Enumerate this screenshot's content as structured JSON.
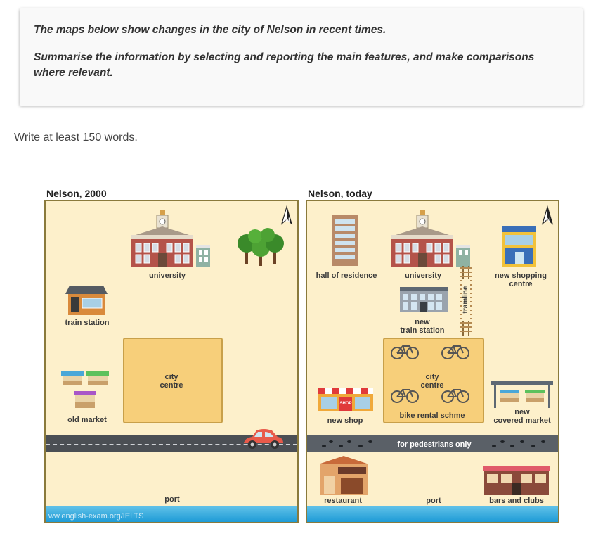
{
  "task": {
    "line1": "The maps below show changes in the city of Nelson in recent times.",
    "line2": "Summarise the information by selecting and reporting the main features, and make comparisons where relevant."
  },
  "instruction": "Write at least 150 words.",
  "map_2000": {
    "title": "Nelson, 2000",
    "labels": {
      "university": "university",
      "train_station": "train station",
      "city_centre": "city\ncentre",
      "old_market": "old market",
      "port": "port"
    },
    "north": "N",
    "watermark": "ww.english-exam.org/IELTS"
  },
  "map_today": {
    "title": "Nelson, today",
    "labels": {
      "hall": "hall of residence",
      "university": "university",
      "tramline": "tramline",
      "shopping": "new shopping\ncentre",
      "train_station": "new\ntrain station",
      "city_centre": "city\ncentre",
      "bike": "bike rental schme",
      "new_shop": "new shop",
      "covered_market": "new\ncovered market",
      "pedestrians": "for pedestrians only",
      "restaurant": "restaurant",
      "port": "port",
      "bars": "bars and clubs",
      "shop_sign": "SHOP"
    },
    "north": "N"
  },
  "colors": {
    "map_bg": "#fdf0cb",
    "road": "#4b4f54",
    "water": "#1e9bd6",
    "city_centre": "#f7cf7a"
  }
}
